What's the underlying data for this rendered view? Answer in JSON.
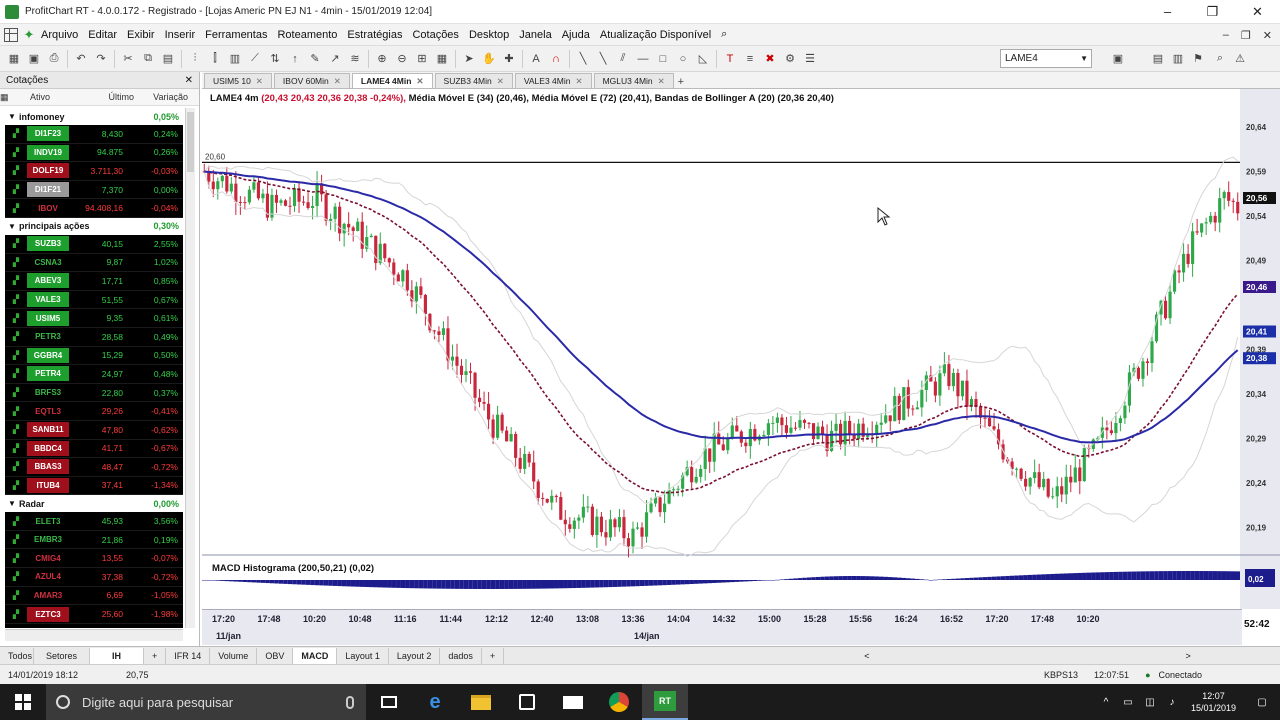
{
  "window": {
    "title": "ProfitChart RT - 4.0.0.172 - Registrado - [Lojas Americ PN EJ N1 - 4min - 15/01/2019 12:04]",
    "controls": [
      "–",
      "❐",
      "✕"
    ]
  },
  "menu": [
    "Arquivo",
    "Editar",
    "Exibir",
    "Inserir",
    "Ferramentas",
    "Roteamento",
    "Estratégias",
    "Cotações",
    "Desktop",
    "Janela",
    "Ajuda",
    "Atualização Disponível"
  ],
  "toolbar": {
    "ticker": "LAME4"
  },
  "quotes_panel": {
    "title": "Cotações",
    "columns": [
      "Ativo",
      "Último",
      "Variação"
    ],
    "groups": [
      {
        "name": "infomoney",
        "pct": "0,05%",
        "rows": [
          {
            "sym": "DI1F23",
            "last": "8,430",
            "var": "0,24%",
            "color": "#1e9e2d"
          },
          {
            "sym": "INDV19",
            "last": "94.875",
            "var": "0,26%",
            "color": "#1e9e2d"
          },
          {
            "sym": "DOLF19",
            "last": "3.711,30",
            "var": "-0,03%",
            "color": "#a0101c"
          },
          {
            "sym": "DI1F21",
            "last": "7,370",
            "var": "0,00%",
            "color": "#9a9a9a"
          },
          {
            "sym": "IBOV",
            "last": "94.408,16",
            "var": "-0,04%",
            "color": "#000000"
          }
        ]
      },
      {
        "name": "principais ações",
        "pct": "0,30%",
        "rows": [
          {
            "sym": "SUZB3",
            "last": "40,15",
            "var": "2,55%",
            "color": "#1e9e2d"
          },
          {
            "sym": "CSNA3",
            "last": "9,87",
            "var": "1,02%",
            "color": "#000000"
          },
          {
            "sym": "ABEV3",
            "last": "17,71",
            "var": "0,85%",
            "color": "#1e9e2d"
          },
          {
            "sym": "VALE3",
            "last": "51,55",
            "var": "0,67%",
            "color": "#1e9e2d"
          },
          {
            "sym": "USIM5",
            "last": "9,35",
            "var": "0,61%",
            "color": "#1e9e2d"
          },
          {
            "sym": "PETR3",
            "last": "28,58",
            "var": "0,49%",
            "color": "#000000"
          },
          {
            "sym": "GGBR4",
            "last": "15,29",
            "var": "0,50%",
            "color": "#1e9e2d"
          },
          {
            "sym": "PETR4",
            "last": "24,97",
            "var": "0,48%",
            "color": "#1e9e2d"
          },
          {
            "sym": "BRFS3",
            "last": "22,80",
            "var": "0,37%",
            "color": "#000000"
          },
          {
            "sym": "EQTL3",
            "last": "29,26",
            "var": "-0,41%",
            "color": "#000000"
          },
          {
            "sym": "SANB11",
            "last": "47,80",
            "var": "-0,62%",
            "color": "#a0101c"
          },
          {
            "sym": "BBDC4",
            "last": "41,71",
            "var": "-0,67%",
            "color": "#a0101c"
          },
          {
            "sym": "BBAS3",
            "last": "48,47",
            "var": "-0,72%",
            "color": "#a0101c"
          },
          {
            "sym": "ITUB4",
            "last": "37,41",
            "var": "-1,34%",
            "color": "#a0101c"
          }
        ]
      },
      {
        "name": "Radar",
        "pct": "0,00%",
        "rows": [
          {
            "sym": "ELET3",
            "last": "45,93",
            "var": "3,56%",
            "color": "#000000"
          },
          {
            "sym": "EMBR3",
            "last": "21,86",
            "var": "0,19%",
            "color": "#000000"
          },
          {
            "sym": "CMIG4",
            "last": "13,55",
            "var": "-0,07%",
            "color": "#000000"
          },
          {
            "sym": "AZUL4",
            "last": "37,38",
            "var": "-0,72%",
            "color": "#000000"
          },
          {
            "sym": "AMAR3",
            "last": "6,69",
            "var": "-1,05%",
            "color": "#000000"
          },
          {
            "sym": "EZTC3",
            "last": "25,60",
            "var": "-1,98%",
            "color": "#a0101c"
          }
        ]
      }
    ]
  },
  "chart_tabs": [
    {
      "label": "USIM5 10",
      "active": false
    },
    {
      "label": "IBOV 60Min",
      "active": false
    },
    {
      "label": "LAME4 4Min",
      "active": true
    },
    {
      "label": "SUZB3 4Min",
      "active": false
    },
    {
      "label": "VALE3 4Min",
      "active": false
    },
    {
      "label": "MGLU3 4Min",
      "active": false
    }
  ],
  "legend": {
    "title": "LAME4 4m",
    "values": "(20,43  20,43  20,36  20,38  -0,24%),",
    "indicators": "Média Móvel E (34) (20,46), Média Móvel E (72) (20,41), Bandas de Bollinger A (20) (20,36  20,40)"
  },
  "macd_label": "MACD Histograma (200,50,21) (0,02)",
  "price_axis": [
    "20,64",
    "20,59",
    "20,54",
    "20,49",
    "20,39",
    "20,34",
    "20,29",
    "20,24",
    "20,19"
  ],
  "price_flags": [
    {
      "label": "20,56",
      "bg": "#111111"
    },
    {
      "label": "20,46",
      "bg": "#3a1a8a"
    },
    {
      "label": "20,41",
      "bg": "#1b2fa8"
    },
    {
      "label": "20,38",
      "bg": "#1b2fa8"
    }
  ],
  "hline_label": "20,60",
  "macd_flag": "0,02",
  "time_axis": {
    "times": [
      "17:20",
      "17:48",
      "10:20",
      "10:48",
      "11:16",
      "11:44",
      "12:12",
      "12:40",
      "13:08",
      "13:36",
      "14:04",
      "14:32",
      "15:00",
      "15:28",
      "15:56",
      "16:24",
      "16:52",
      "17:20",
      "17:48",
      "10:20"
    ],
    "dates": [
      "11/jan",
      "14/jan"
    ],
    "clock": "52:42"
  },
  "bottom_tabs": {
    "panel": [
      "Todos",
      "Setores",
      "IH"
    ],
    "chart": [
      "IFR 14",
      "Volume",
      "OBV",
      "MACD",
      "Layout 1",
      "Layout 2",
      "dados"
    ],
    "active_chart": "MACD"
  },
  "status": {
    "datetime": "14/01/2019 18:12",
    "value": "20,75",
    "speed": "KBPS13",
    "time": "12:07:51",
    "connection": "Conectado"
  },
  "taskbar": {
    "search_placeholder": "Digite aqui para pesquisar",
    "time": "12:07",
    "date": "15/01/2019"
  },
  "chart_data": {
    "type": "candlestick",
    "ticker": "LAME4",
    "interval": "4m",
    "ylim": [
      20.16,
      20.66
    ],
    "x_labels": [
      "17:20",
      "17:48",
      "10:20",
      "10:48",
      "11:16",
      "11:44",
      "12:12",
      "12:40",
      "13:08",
      "13:36",
      "14:04",
      "14:32",
      "15:00",
      "15:28",
      "15:56",
      "16:24",
      "16:52",
      "17:20",
      "17:48",
      "10:20"
    ],
    "horizontal_line": 20.6,
    "ema34_last": 20.46,
    "ema72_last": 20.41,
    "bollinger": [
      20.36,
      20.4
    ],
    "last": {
      "open": 20.43,
      "high": 20.43,
      "low": 20.36,
      "close": 20.38,
      "change_pct": -0.24
    },
    "macd_histogram": {
      "params": "200,50,21",
      "value": 0.02
    }
  }
}
